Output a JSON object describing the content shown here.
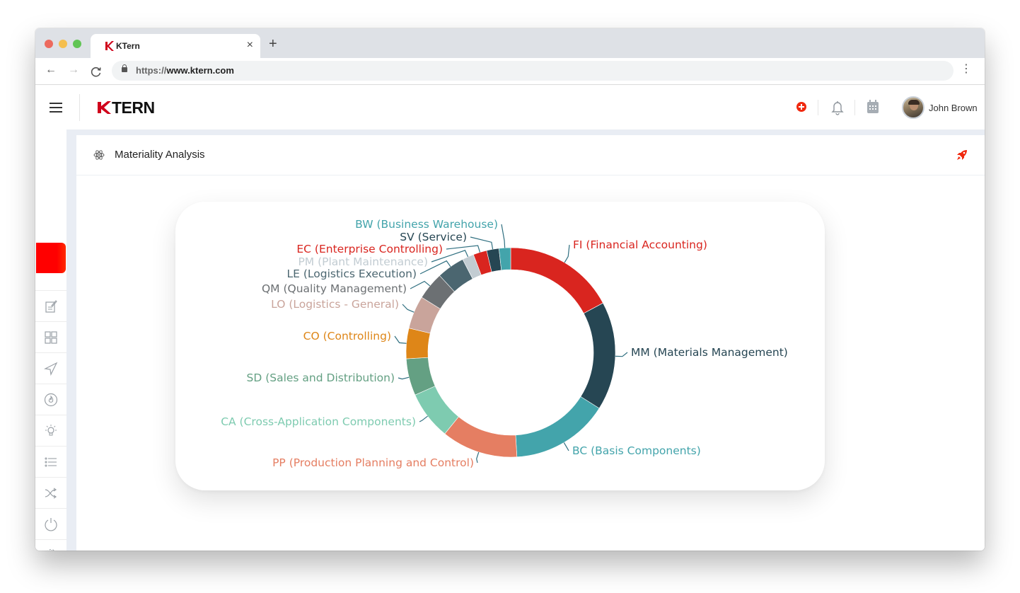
{
  "browser": {
    "tab_title": "KTern",
    "tab_close": "×",
    "new_tab": "+",
    "url_protocol": "https://",
    "url_host": "www.ktern.com",
    "back": "←",
    "forward": "→",
    "reload": "C",
    "menu": "⋮"
  },
  "header": {
    "brand": "TERN",
    "user_name": "John Brown",
    "icons": [
      "menu-icon",
      "add-circle-icon",
      "bell-icon",
      "calendar-icon",
      "avatar"
    ]
  },
  "sidebar": {
    "items": [
      {
        "name": "edit-note-icon"
      },
      {
        "name": "grid-icon"
      },
      {
        "name": "send-icon"
      },
      {
        "name": "flame-icon"
      },
      {
        "name": "lightbulb-icon"
      },
      {
        "name": "list-icon"
      },
      {
        "name": "shuffle-icon"
      },
      {
        "name": "power-icon"
      },
      {
        "name": "gear-icon"
      }
    ]
  },
  "page": {
    "title": "Materiality Analysis",
    "title_icon": "atom-icon",
    "action_icon": "rocket-icon"
  },
  "chart_data": {
    "type": "pie",
    "variant": "donut",
    "unit": "percent",
    "start_angle": "top, clockwise",
    "slices": [
      {
        "label": "FI (Financial Accounting)",
        "value": 17.2,
        "color": "#d9251f"
      },
      {
        "label": "MM (Materials Management)",
        "value": 16.8,
        "color": "#264653"
      },
      {
        "label": "BC (Basis Components)",
        "value": 15.1,
        "color": "#43a4ab"
      },
      {
        "label": "PP (Production Planning and Control)",
        "value": 11.8,
        "color": "#e57e62"
      },
      {
        "label": "CA (Cross-Application Components)",
        "value": 7.5,
        "color": "#7ecbb0"
      },
      {
        "label": "SD (Sales and Distribution)",
        "value": 5.7,
        "color": "#64a083"
      },
      {
        "label": "CO (Controlling)",
        "value": 4.7,
        "color": "#de8618"
      },
      {
        "label": "LO (Logistics - General)",
        "value": 5.1,
        "color": "#c9a49b"
      },
      {
        "label": "QM (Quality Management)",
        "value": 4.3,
        "color": "#6c7073"
      },
      {
        "label": "LE (Logistics Execution)",
        "value": 4.3,
        "color": "#4b6670"
      },
      {
        "label": "PM (Plant Maintenance)",
        "value": 1.8,
        "color": "#c2ccd2"
      },
      {
        "label": "EC (Enterprise Controlling)",
        "value": 2.1,
        "color": "#d9251f"
      },
      {
        "label": "SV (Service)",
        "value": 1.9,
        "color": "#264653"
      },
      {
        "label": "BW (Business Warehouse)",
        "value": 1.8,
        "color": "#43a4ab"
      }
    ],
    "title": "",
    "legend": "none (labels outside slices with leader lines)"
  }
}
